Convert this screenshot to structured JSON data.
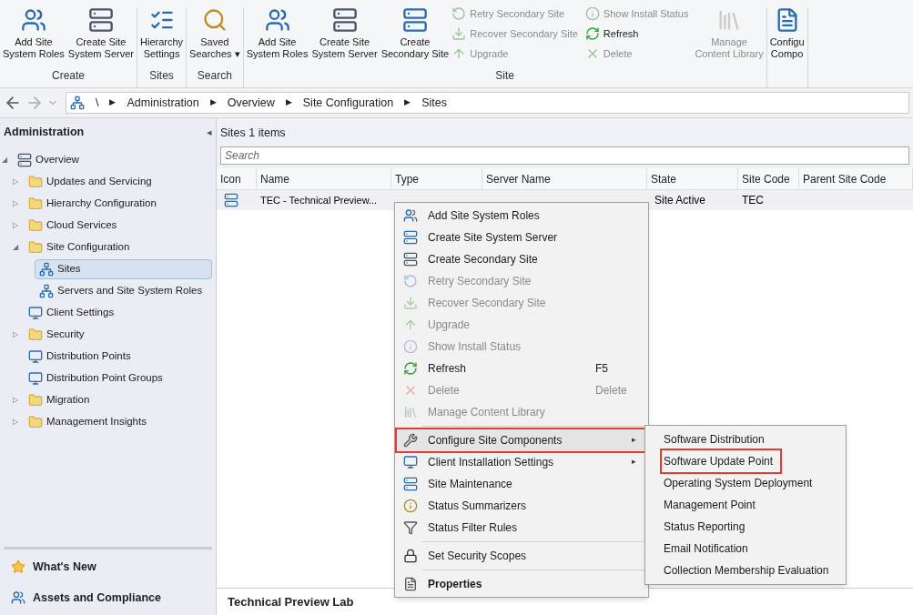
{
  "ribbon": {
    "groups": [
      {
        "label": "Create",
        "buttons": [
          {
            "label": "Add Site\nSystem Roles",
            "kind": "large",
            "disabled": false
          },
          {
            "label": "Create Site\nSystem Server",
            "kind": "large",
            "disabled": false
          }
        ]
      },
      {
        "label": "Sites",
        "buttons": [
          {
            "label": "Hierarchy\nSettings",
            "kind": "large",
            "disabled": false
          }
        ]
      },
      {
        "label": "Search",
        "buttons": [
          {
            "label": "Saved\nSearches",
            "kind": "large",
            "disabled": false,
            "dropdown": "▾"
          }
        ]
      },
      {
        "label": "Site",
        "buttons": [
          {
            "label": "Add Site\nSystem Roles",
            "kind": "large",
            "disabled": false
          },
          {
            "label": "Create Site\nSystem Server",
            "kind": "large",
            "disabled": false
          },
          {
            "label": "Create\nSecondary Site",
            "kind": "large",
            "disabled": false
          },
          {
            "label": "Retry Secondary Site",
            "kind": "small",
            "disabled": true
          },
          {
            "label": "Recover Secondary Site",
            "kind": "small",
            "disabled": true
          },
          {
            "label": "Upgrade",
            "kind": "small",
            "disabled": true
          },
          {
            "label": "Show Install Status",
            "kind": "small",
            "disabled": true
          },
          {
            "label": "Refresh",
            "kind": "small",
            "disabled": false
          },
          {
            "label": "Delete",
            "kind": "small",
            "disabled": true
          },
          {
            "label": "Manage\nContent Library",
            "kind": "large",
            "disabled": true
          }
        ]
      },
      {
        "buttons": [
          {
            "label": "Configu\nCompo",
            "kind": "large",
            "disabled": false
          }
        ]
      }
    ]
  },
  "breadcrumb": {
    "separator": "▶",
    "items": [
      "\\",
      "Administration",
      "Overview",
      "Site Configuration",
      "Sites"
    ]
  },
  "sidebar": {
    "title": "Administration",
    "collapse": "◂",
    "tree": [
      {
        "label": "Overview",
        "expander": "◢",
        "selected": false,
        "children": [
          {
            "label": "Updates and Servicing",
            "expander": "▷",
            "selected": false
          },
          {
            "label": "Hierarchy Configuration",
            "expander": "▷",
            "selected": false
          },
          {
            "label": "Cloud Services",
            "expander": "▷",
            "selected": false
          },
          {
            "label": "Site Configuration",
            "expander": "◢",
            "selected": false,
            "children": [
              {
                "label": "Sites",
                "selected": true
              },
              {
                "label": "Servers and Site System Roles",
                "selected": false
              }
            ]
          },
          {
            "label": "Client Settings",
            "selected": false
          },
          {
            "label": "Security",
            "expander": "▷",
            "selected": false
          },
          {
            "label": "Distribution Points",
            "selected": false
          },
          {
            "label": "Distribution Point Groups",
            "selected": false
          },
          {
            "label": "Migration",
            "expander": "▷",
            "selected": false
          },
          {
            "label": "Management Insights",
            "expander": "▷",
            "selected": false
          }
        ]
      }
    ],
    "workspaces": [
      "What's New",
      "Assets and Compliance"
    ]
  },
  "content": {
    "title": "Sites 1 items",
    "search": {
      "placeholder": "Search"
    },
    "table": {
      "columns": [
        "Icon",
        "Name",
        "Type",
        "Server Name",
        "State",
        "Site Code",
        "Parent Site Code"
      ],
      "rows": [
        {
          "name": "TEC - Technical Preview...",
          "state": "Site Active",
          "site_code": "TEC"
        }
      ]
    },
    "details_title": "Technical Preview Lab"
  },
  "context_menu": {
    "items": [
      {
        "label": "Add Site System Roles",
        "disabled": false,
        "highlighted": false
      },
      {
        "label": "Create Site System Server",
        "disabled": false,
        "highlighted": false
      },
      {
        "label": "Create Secondary Site",
        "disabled": false,
        "highlighted": false
      },
      {
        "label": "Retry Secondary Site",
        "disabled": true,
        "highlighted": false
      },
      {
        "label": "Recover Secondary Site",
        "disabled": true,
        "highlighted": false
      },
      {
        "label": "Upgrade",
        "disabled": true,
        "highlighted": false
      },
      {
        "label": "Show Install Status",
        "disabled": true,
        "highlighted": false
      },
      {
        "label": "Refresh",
        "disabled": false,
        "highlighted": false,
        "shortcut": "F5"
      },
      {
        "label": "Delete",
        "disabled": true,
        "highlighted": false,
        "shortcut": "Delete"
      },
      {
        "label": "Manage Content Library",
        "disabled": true,
        "highlighted": false
      },
      {
        "label": "Configure Site Components",
        "disabled": false,
        "highlighted": true,
        "separator_before": true,
        "submenu": "▸"
      },
      {
        "label": "Client Installation Settings",
        "disabled": false,
        "highlighted": false,
        "submenu": "▸"
      },
      {
        "label": "Site Maintenance",
        "disabled": false,
        "highlighted": false
      },
      {
        "label": "Status Summarizers",
        "disabled": false,
        "highlighted": false
      },
      {
        "label": "Status Filter Rules",
        "disabled": false,
        "highlighted": false
      },
      {
        "label": "Set Security Scopes",
        "disabled": false,
        "highlighted": false,
        "separator_before": true
      },
      {
        "label": "Properties",
        "disabled": false,
        "highlighted": false,
        "separator_before": true,
        "bold": true
      }
    ]
  },
  "submenu": {
    "items": [
      {
        "label": "Software Distribution",
        "highlighted": false
      },
      {
        "label": "Software Update Point",
        "highlighted": true
      },
      {
        "label": "Operating System Deployment",
        "highlighted": false
      },
      {
        "label": "Management Point",
        "highlighted": false
      },
      {
        "label": "Status Reporting",
        "highlighted": false
      },
      {
        "label": "Email Notification",
        "highlighted": false
      },
      {
        "label": "Collection Membership Evaluation",
        "highlighted": false
      }
    ]
  }
}
